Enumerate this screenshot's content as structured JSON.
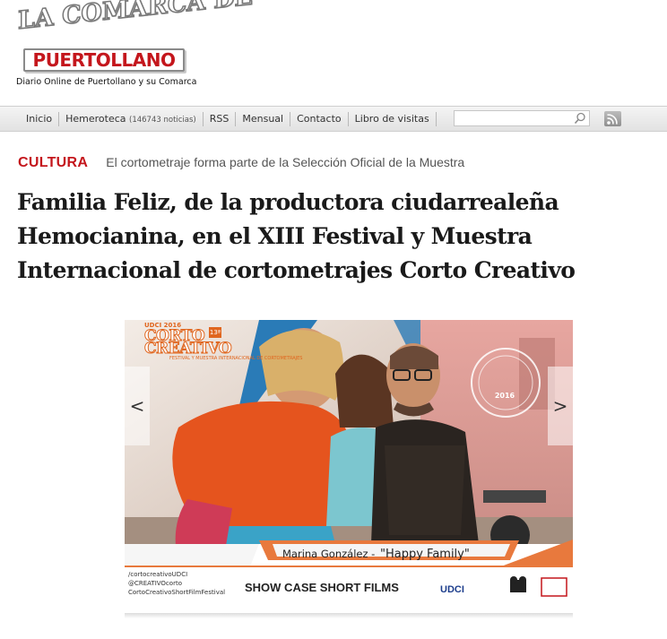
{
  "site": {
    "logo_top": "LA COMARCA DE",
    "logo_main": "PUERTOLLANO",
    "tagline": "Diario Online de Puertollano y su Comarca"
  },
  "nav": {
    "items": [
      {
        "label": "Inicio"
      },
      {
        "label": "Hemeroteca",
        "count": "(146743 noticias)"
      },
      {
        "label": "RSS"
      },
      {
        "label": "Mensual"
      },
      {
        "label": "Contacto"
      },
      {
        "label": "Libro de visitas"
      }
    ],
    "search": {
      "value": "",
      "placeholder": ""
    },
    "rss_icon": "rss-feed-icon"
  },
  "article": {
    "section": "CULTURA",
    "subtitle": "El cortometraje forma parte de la Selección Oficial de la Muestra",
    "headline": "Familia Feliz, de la productora ciudarrealeña Hemocianina, en el XIII Festival y Muestra Internacional de cortometrajes Corto Creativo"
  },
  "slider": {
    "prev": "<",
    "next": ">",
    "poster": {
      "logo_year": "UDCI 2016",
      "logo_line1": "CORTO",
      "logo_line2": "CREATIVO",
      "edition": "13ª",
      "logo_tagline": "FESTIVAL Y MUESTRA INTERNACIONAL DE CORTOMETRAJES",
      "seal": "2016",
      "caption_name": "Marina González -",
      "caption_film": "\"Happy Family\"",
      "band_text": "SHOW CASE SHORT FILMS",
      "social": [
        "/cortocreativoUDCI",
        "@CREATIVOcorto",
        "CortoCreativoShortFilmFestival"
      ],
      "udci_logo": "UDCI"
    }
  }
}
